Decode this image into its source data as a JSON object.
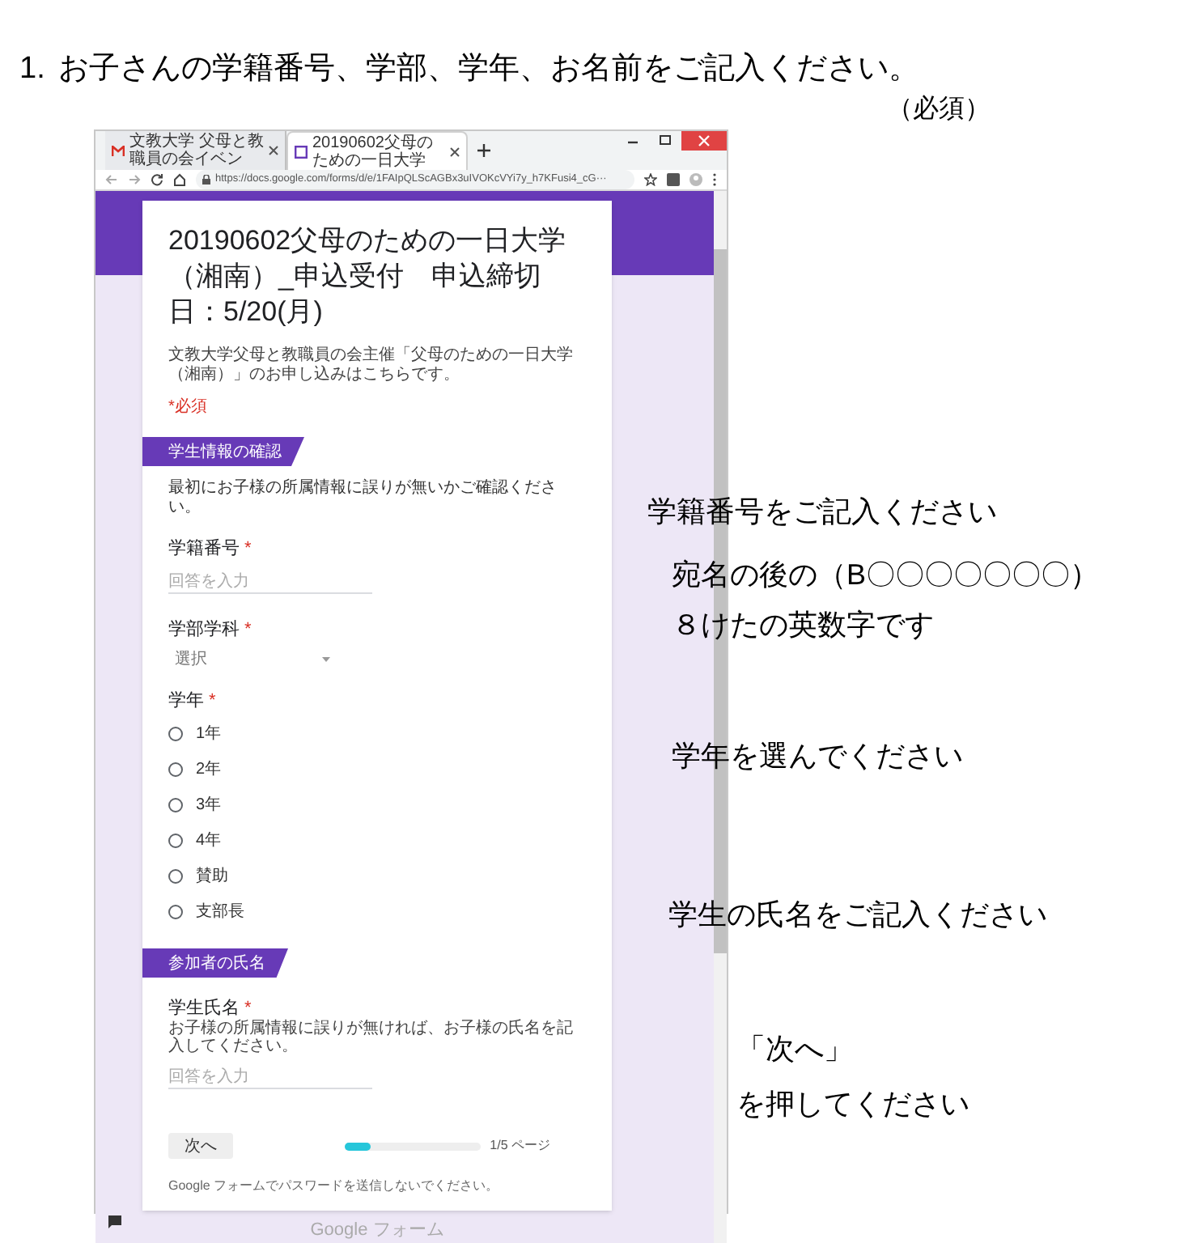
{
  "instruction": {
    "number": "1.",
    "text": "お子さんの学籍番号、学部、学年、お名前をご記入ください。"
  },
  "required_note": "（必須）",
  "browser": {
    "tabs": [
      {
        "title": "文教大学 父母と教職員の会イベン",
        "selected": false
      },
      {
        "title": "20190602父母のための一日大学",
        "selected": true
      }
    ],
    "url": "https://docs.google.com/forms/d/e/1FAIpQLScAGBx3uIVOKcVYi7y_h7KFusi4_cG···"
  },
  "form": {
    "title": "20190602父母のための一日大学（湘南）_申込受付　申込締切日：5/20(月)",
    "description": "文教大学父母と教職員の会主催「父母のための一日大学（湘南）」のお申し込みはこちらです。",
    "required_legend": "*必須",
    "sections": [
      {
        "header": "学生情報の確認",
        "description": "最初にお子様の所属情報に誤りが無いかご確認ください。",
        "questions": [
          {
            "kind": "text",
            "label": "学籍番号",
            "required_mark": "*",
            "placeholder": "回答を入力"
          },
          {
            "kind": "dropdown",
            "label": "学部学科",
            "required_mark": "*",
            "placeholder": "選択"
          },
          {
            "kind": "radio",
            "label": "学年",
            "required_mark": "*",
            "options": [
              {
                "label": "1年",
                "selected": false
              },
              {
                "label": "2年",
                "selected": false
              },
              {
                "label": "3年",
                "selected": false
              },
              {
                "label": "4年",
                "selected": false
              },
              {
                "label": "賛助",
                "selected": false
              },
              {
                "label": "支部長",
                "selected": false
              }
            ]
          }
        ]
      },
      {
        "header": "参加者の氏名",
        "questions": [
          {
            "kind": "text",
            "label": "学生氏名",
            "required_mark": "*",
            "help": "お子様の所属情報に誤りが無ければ、お子様の氏名を記入してください。",
            "placeholder": "回答を入力"
          }
        ]
      }
    ],
    "next_button": "次へ",
    "progress": {
      "level": 0.2,
      "label": "1/5 ページ"
    },
    "footer_note": "Google フォームでパスワードを送信しないでください。",
    "brand": "Google フォーム"
  },
  "annotations": [
    {
      "text": "学籍番号をご記入ください"
    },
    {
      "text": "宛名の後の（B〇〇〇〇〇〇〇）"
    },
    {
      "text": "８けたの英数字です"
    },
    {
      "text": "学年を選んでください"
    },
    {
      "text": "学生の氏名をご記入ください"
    },
    {
      "text": "「次へ」"
    },
    {
      "text": "を押してください"
    }
  ]
}
